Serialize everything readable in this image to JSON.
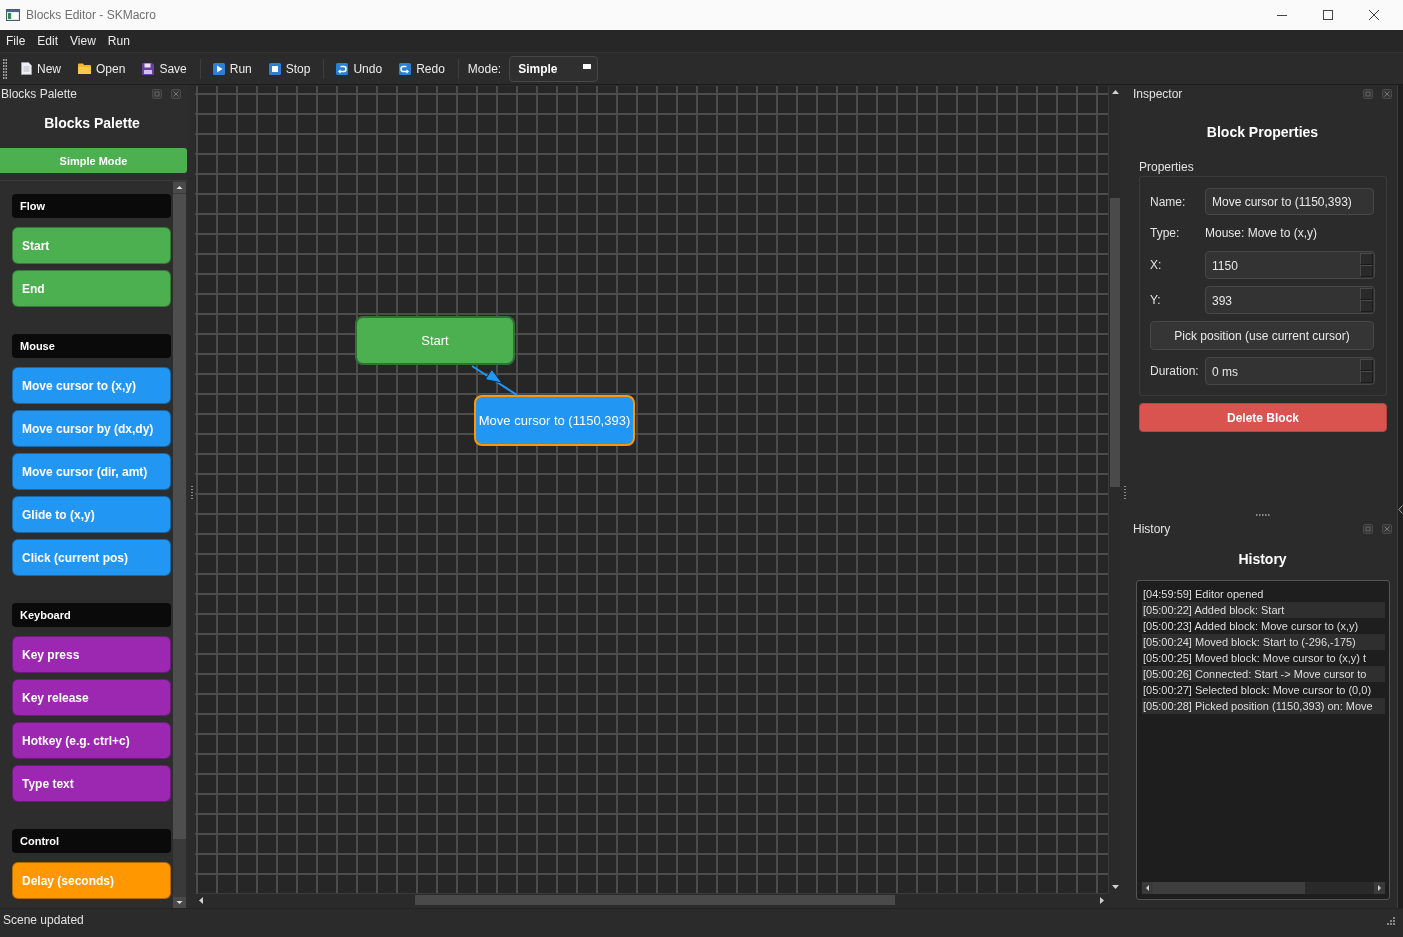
{
  "window": {
    "title": "Blocks Editor - SKMacro"
  },
  "menu": [
    {
      "label": "File"
    },
    {
      "label": "Edit"
    },
    {
      "label": "View"
    },
    {
      "label": "Run"
    }
  ],
  "toolbar": {
    "groups": [
      {
        "buttons": [
          {
            "kind": "new",
            "label": "New"
          },
          {
            "kind": "open",
            "label": "Open"
          },
          {
            "kind": "save",
            "label": "Save"
          }
        ]
      },
      {
        "buttons": [
          {
            "kind": "run",
            "label": "Run"
          },
          {
            "kind": "stop",
            "label": "Stop"
          }
        ]
      },
      {
        "buttons": [
          {
            "kind": "undo",
            "label": "Undo"
          },
          {
            "kind": "redo",
            "label": "Redo"
          }
        ]
      }
    ],
    "mode": {
      "label": "Mode:",
      "value": "Simple"
    }
  },
  "palette": {
    "dock_title": "Blocks Palette",
    "heading": "Blocks Palette",
    "mode_button": "Simple Mode",
    "categories": [
      {
        "name": "Flow",
        "color": "#4caf50",
        "blocks": [
          "Start",
          "End"
        ]
      },
      {
        "name": "Mouse",
        "color": "#2196f3",
        "blocks": [
          "Move cursor to (x,y)",
          "Move cursor by (dx,dy)",
          "Move cursor (dir, amt)",
          "Glide to (x,y)",
          "Click (current pos)"
        ]
      },
      {
        "name": "Keyboard",
        "color": "#9c27b0",
        "blocks": [
          "Key press",
          "Key release",
          "Hotkey (e.g. ctrl+c)",
          "Type text"
        ]
      },
      {
        "name": "Control",
        "color": "#ff9800",
        "blocks": [
          "Delay (seconds)"
        ]
      }
    ]
  },
  "canvas": {
    "nodes": [
      {
        "label": "Start",
        "color": "#4caf50",
        "selected": false
      },
      {
        "label": "Move cursor to (1150,393)",
        "color": "#2196f3",
        "selected": true
      }
    ]
  },
  "inspector": {
    "dock_title": "Inspector",
    "heading": "Block Properties",
    "group_title": "Properties",
    "fields": [
      {
        "kind": "text",
        "label": "Name:",
        "value": "Move cursor to (1150,393)"
      },
      {
        "kind": "static",
        "label": "Type:",
        "value": "Mouse: Move to (x,y)"
      },
      {
        "kind": "spin",
        "label": "X:",
        "value": "1150"
      },
      {
        "kind": "spin",
        "label": "Y:",
        "value": "393"
      },
      {
        "kind": "button",
        "label": "Pick position (use current cursor)"
      },
      {
        "kind": "spin",
        "label": "Duration:",
        "value": "0 ms"
      }
    ],
    "delete_button": "Delete Block"
  },
  "history": {
    "dock_title": "History",
    "heading": "History",
    "entries": [
      "[04:59:59] Editor opened",
      "[05:00:22] Added block: Start",
      "[05:00:23] Added block: Move cursor to (x,y)",
      "[05:00:24] Moved block: Start to (-296,-175)",
      "[05:00:25] Moved block: Move cursor to (x,y) t",
      "[05:00:26] Connected: Start -> Move cursor to",
      "[05:00:27] Selected block: Move cursor to (0,0)",
      "[05:00:28] Picked position (1150,393) on: Move"
    ]
  },
  "status_bar": {
    "message": "Scene updated"
  }
}
